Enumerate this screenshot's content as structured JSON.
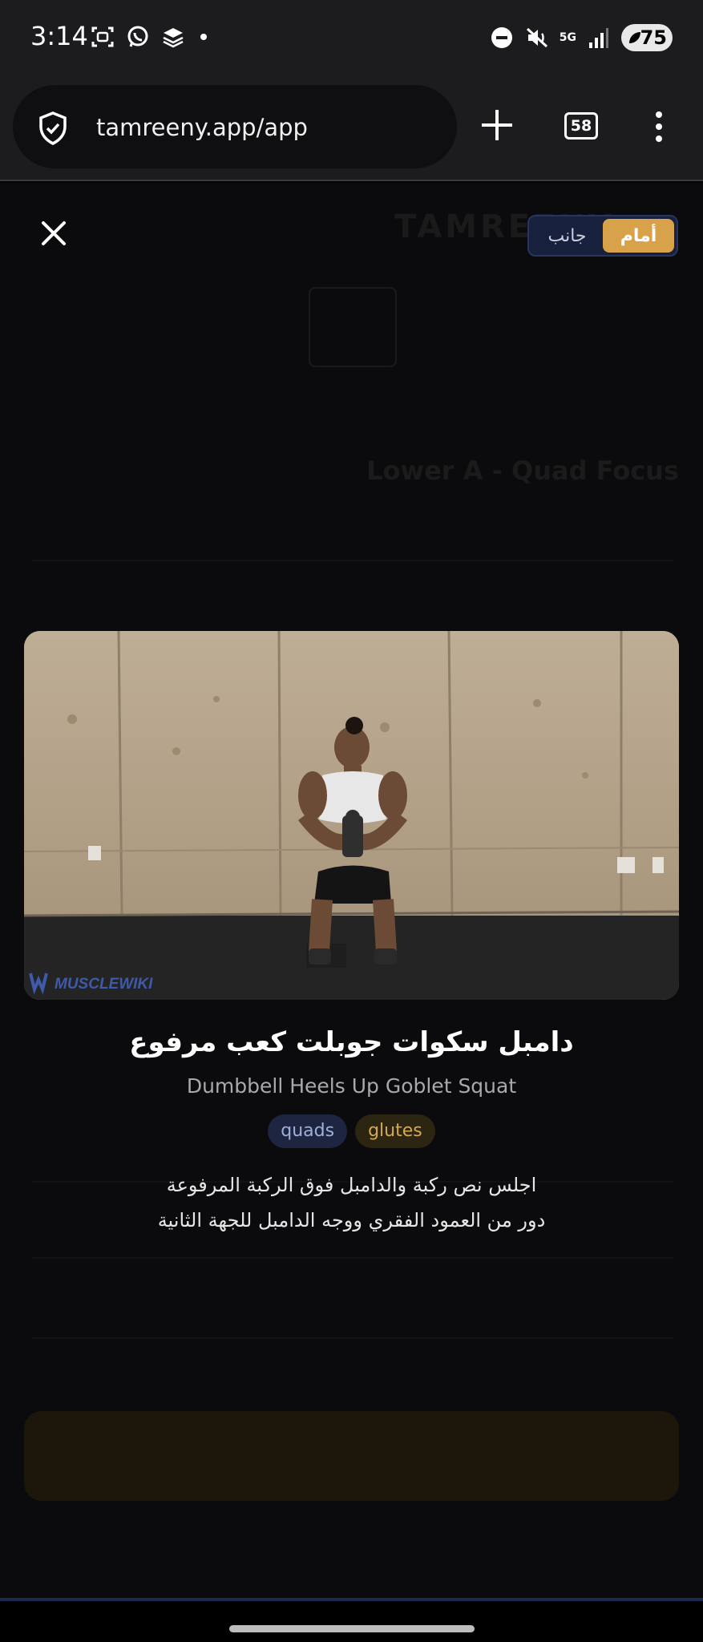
{
  "status_bar": {
    "time": "3:14",
    "network": "5G",
    "battery": "75"
  },
  "browser": {
    "url": "tamreeny.app/app",
    "tab_count": "58"
  },
  "background": {
    "brand": "TAMREENY",
    "workout_title": "Lower A - Quad Focus"
  },
  "modal": {
    "view_toggle": {
      "front_label": "أمام",
      "side_label": "جانب",
      "active": "front"
    },
    "video_watermark": "MUSCLEWIKI",
    "exercise_name_ar": "دامبل سكوات جوبلت كعب مرفوع",
    "exercise_name_en": "Dumbbell Heels Up Goblet Squat",
    "tags": [
      "quads",
      "glutes"
    ],
    "description_line1": "اجلس نص ركبة والدامبل فوق الركبة المرفوعة",
    "description_line2": "دور من العمود الفقري ووجه الدامبل للجهة الثانية"
  },
  "colors": {
    "accent_gold": "#d8a24a",
    "toggle_bg": "#17213d",
    "tag_quads_bg": "#1d2540",
    "tag_glutes_bg": "#2c2512"
  },
  "icons": {
    "close": "close-icon",
    "shield": "shield-icon",
    "plus": "plus-icon",
    "menu": "more-vert-icon"
  }
}
